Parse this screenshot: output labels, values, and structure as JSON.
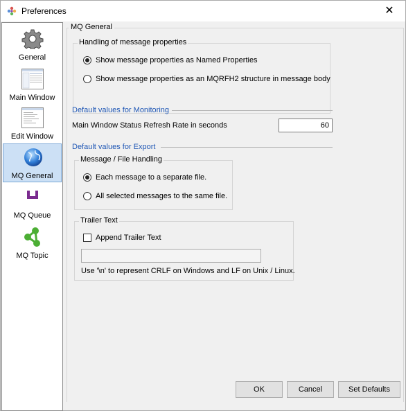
{
  "window": {
    "title": "Preferences",
    "close_glyph": "✕"
  },
  "sidebar": {
    "items": [
      {
        "label": "General",
        "icon": "gear-icon"
      },
      {
        "label": "Main Window",
        "icon": "window-thumbnail-icon"
      },
      {
        "label": "Edit Window",
        "icon": "edit-window-thumbnail-icon"
      },
      {
        "label": "MQ General",
        "icon": "globe-icon",
        "selected": true
      },
      {
        "label": "MQ Queue",
        "icon": "queue-icon"
      },
      {
        "label": "MQ Topic",
        "icon": "topic-network-icon"
      }
    ]
  },
  "main": {
    "legend": "MQ General",
    "message_properties": {
      "title": "Handling of message properties",
      "options": [
        {
          "label": "Show message properties as Named Properties",
          "checked": true
        },
        {
          "label": "Show message properties as an MQRFH2 structure in message body",
          "checked": false
        }
      ]
    },
    "monitoring": {
      "title": "Default values for Monitoring",
      "refresh_label": "Main Window Status Refresh Rate in seconds",
      "refresh_value": "60"
    },
    "export": {
      "title": "Default values for Export",
      "file_handling": {
        "title": "Message / File Handling",
        "options": [
          {
            "label": "Each message to a separate file.",
            "checked": true
          },
          {
            "label": "All selected messages to the same file.",
            "checked": false
          }
        ]
      },
      "trailer": {
        "title": "Trailer Text",
        "checkbox_label": "Append Trailer Text",
        "checked": false,
        "input_value": "",
        "hint": "Use '\\n' to represent CRLF on Windows and LF on Unix / Linux."
      }
    }
  },
  "buttons": {
    "ok": "OK",
    "cancel": "Cancel",
    "set_defaults": "Set Defaults"
  },
  "colors": {
    "section_title": "#1f57b5",
    "selected_bg": "#cce0f5"
  }
}
